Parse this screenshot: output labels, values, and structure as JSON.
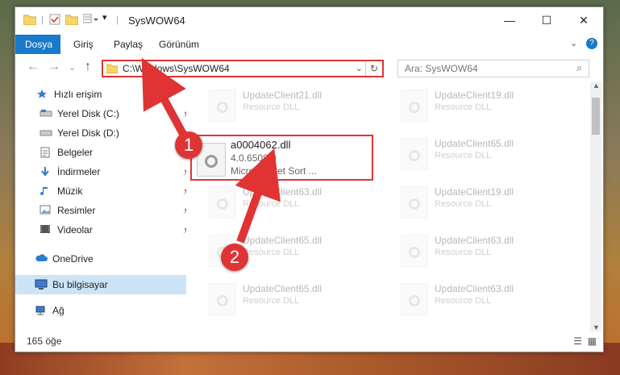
{
  "window": {
    "title": "SysWOW64",
    "controls": {
      "minimize": "—",
      "maximize": "☐",
      "close": "✕"
    }
  },
  "ribbon": {
    "tabs": [
      {
        "label": "Dosya",
        "active": true
      },
      {
        "label": "Giriş"
      },
      {
        "label": "Paylaş"
      },
      {
        "label": "Görünüm"
      }
    ]
  },
  "address": {
    "path": "C:\\Windows\\SysWOW64",
    "search_placeholder": "Ara: SysWOW64"
  },
  "sidebar": {
    "items": [
      {
        "label": "Hızlı erişim",
        "icon": "star-icon"
      },
      {
        "label": "Yerel Disk (C:)",
        "icon": "drive-icon",
        "pinned": true
      },
      {
        "label": "Yerel Disk (D:)",
        "icon": "drive-icon",
        "pinned": true
      },
      {
        "label": "Belgeler",
        "icon": "documents-icon",
        "pinned": true
      },
      {
        "label": "İndirmeler",
        "icon": "download-icon",
        "pinned": true
      },
      {
        "label": "Müzik",
        "icon": "music-icon",
        "pinned": true
      },
      {
        "label": "Resimler",
        "icon": "pictures-icon",
        "pinned": true
      },
      {
        "label": "Videolar",
        "icon": "videos-icon",
        "pinned": true
      },
      {
        "label": "OneDrive",
        "icon": "cloud-icon"
      },
      {
        "label": "Bu bilgisayar",
        "icon": "computer-icon",
        "selected": true
      },
      {
        "label": "Ağ",
        "icon": "network-icon"
      }
    ]
  },
  "files": {
    "highlight": {
      "name": "a0004062.dll",
      "version": "4.0.6508.0",
      "description": "Microsoft Jet Sort ..."
    },
    "faded": [
      {
        "name": "UpdateClient21.dll",
        "type": "Resource DLL"
      },
      {
        "name": "UpdateClient19.dll",
        "type": "Resource DLL"
      },
      {
        "name": "UpdateClient65.dll",
        "type": "Resource DLL"
      },
      {
        "name": "UpdateClient63.dll",
        "type": "Resource DLL"
      },
      {
        "name": "UpdateClient19.dll",
        "type": "Resource DLL"
      },
      {
        "name": "UpdateClient65.dll",
        "type": "Resource DLL"
      },
      {
        "name": "UpdateClient63.dll",
        "type": "Resource DLL"
      },
      {
        "name": "UpdateClient65.dll",
        "type": "Resource DLL"
      },
      {
        "name": "UpdateClient63.dll",
        "type": "Resource DLL"
      }
    ]
  },
  "status": {
    "count": "165 öğe"
  },
  "annotations": {
    "step1": "1",
    "step2": "2"
  },
  "colors": {
    "accent": "#1979ca",
    "highlight": "#e03434"
  }
}
